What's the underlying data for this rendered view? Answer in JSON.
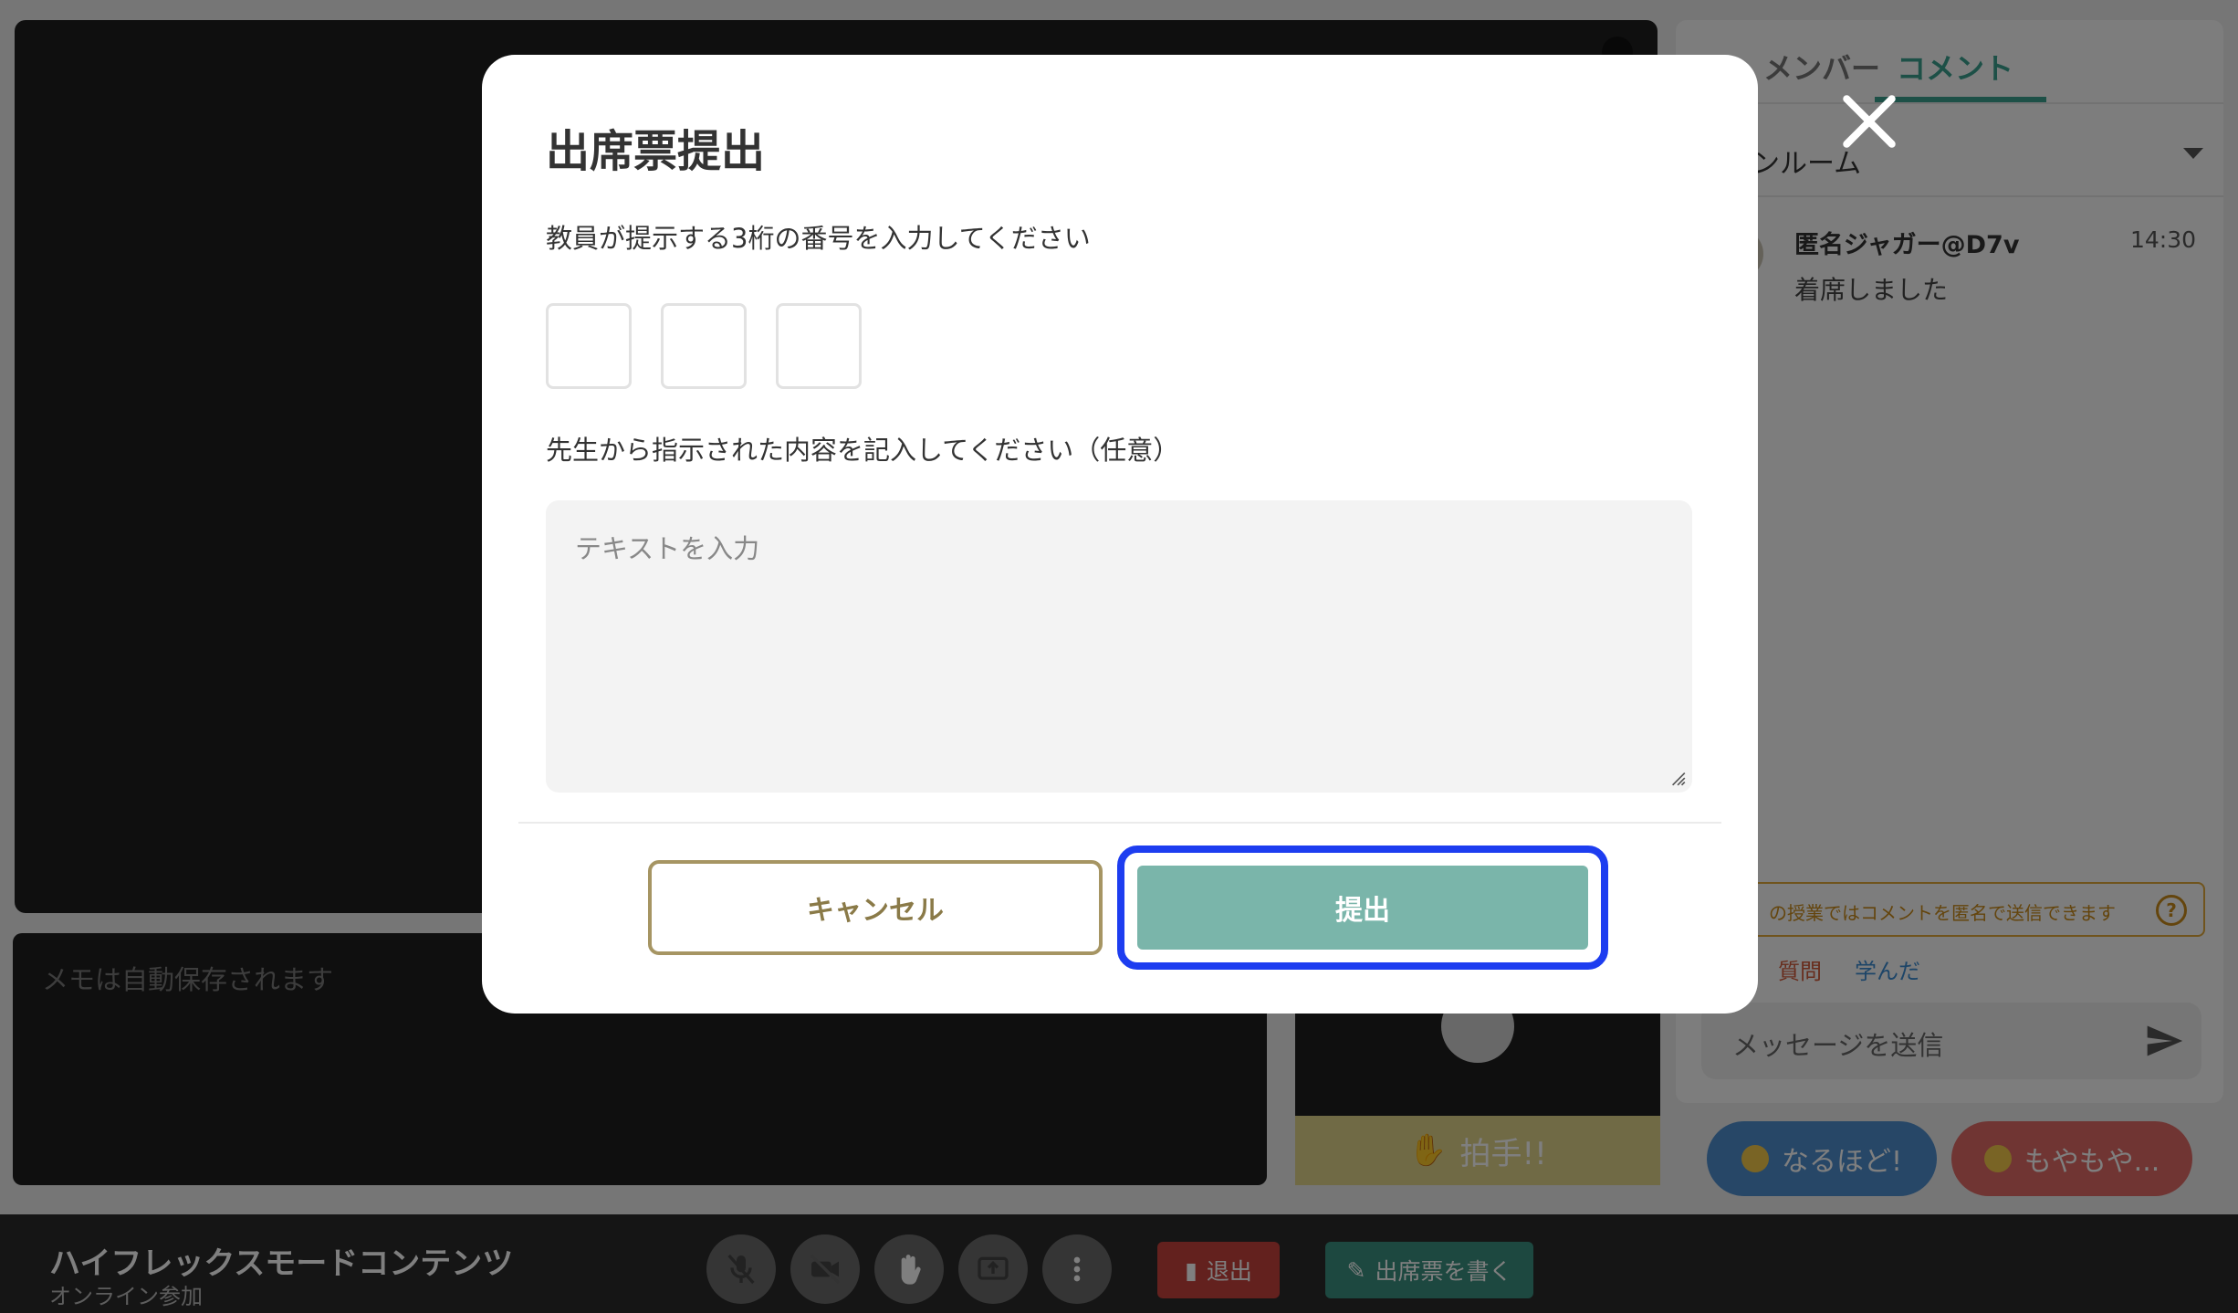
{
  "memo": {
    "placeholder": "メモは自動保存されます"
  },
  "clap": {
    "label": "拍手!!"
  },
  "sidebar": {
    "tabs": [
      {
        "label": "メンバー"
      },
      {
        "label": "コメント"
      }
    ],
    "room": {
      "selected": "ンルーム"
    },
    "messages": [
      {
        "name": "匿名ジャガー@D7v",
        "time": "14:30",
        "text": "着席しました"
      }
    ],
    "anon_notice": "の授業ではコメントを匿名で送信できます",
    "quick_tags": [
      "質問",
      "学んだ"
    ],
    "input": {
      "placeholder": "メッセージを送信"
    }
  },
  "reactions": [
    {
      "label": "なるほど!"
    },
    {
      "label": "もやもや..."
    }
  ],
  "bottombar": {
    "title": "ハイフレックスモードコンテンツ",
    "subtitle": "オンライン参加",
    "exit_label": "退出",
    "write_label": "出席票を書く"
  },
  "modal": {
    "title": "出席票提出",
    "instruction_code": "教員が提示する3桁の番号を入力してください",
    "instruction_text": "先生から指示された内容を記入してください（任意）",
    "text_placeholder": "テキストを入力",
    "cancel_label": "キャンセル",
    "submit_label": "提出"
  },
  "colors": {
    "accent": "#3aa08f",
    "submit": "#7ab5aa",
    "focus_ring": "#1d3df0",
    "cancel_border": "#a69563",
    "exit": "#c7423d"
  }
}
